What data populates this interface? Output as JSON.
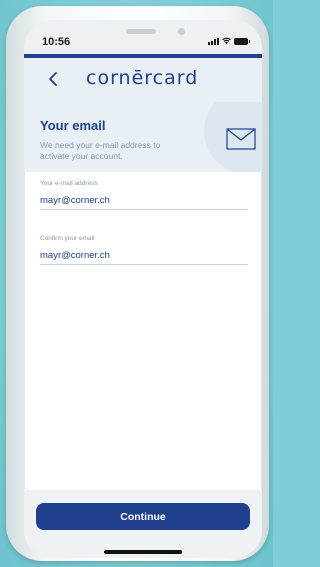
{
  "status_bar": {
    "time": "10:56"
  },
  "header": {
    "brand": "cornērcard",
    "back_icon": "chevron-left-icon"
  },
  "intro": {
    "title": "Your email",
    "description": "We need your e-mail address to activate your account.",
    "icon": "envelope-icon"
  },
  "form": {
    "email": {
      "label": "Your e-mail address",
      "value": "mayr@corner.ch"
    },
    "confirm_email": {
      "label": "Confirm your email",
      "value": "mayr@corner.ch"
    }
  },
  "actions": {
    "continue_label": "Continue"
  },
  "colors": {
    "brand": "#20408f",
    "background": "#84cfd9",
    "header_bg": "#e9f0f5",
    "muted_text": "#8a97a6"
  }
}
